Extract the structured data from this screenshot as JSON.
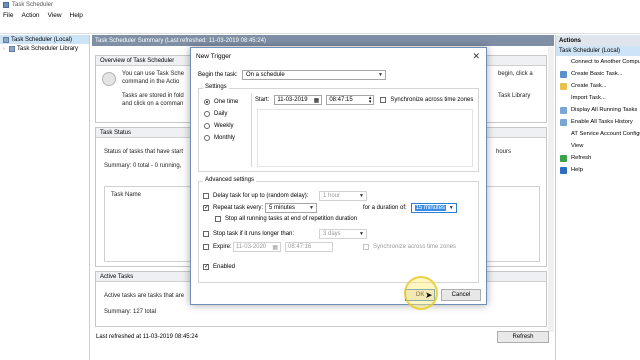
{
  "window": {
    "title": "Task Scheduler"
  },
  "menu": [
    "File",
    "Action",
    "View",
    "Help"
  ],
  "tree": {
    "root": "Task Scheduler (Local)",
    "child": "Task Scheduler Library"
  },
  "center": {
    "header": "Task Scheduler Summary (Last refreshed: 11-03-2019 08:45:24)",
    "overview": {
      "title": "Overview of Task Scheduler",
      "line1": "You can use Task Sche",
      "line2": "command in the Actio",
      "line3": "Tasks are stored in fold",
      "line4": "and click on a comman",
      "right1": "begin, click a",
      "right2": "Task Library"
    },
    "status": {
      "title": "Task Status",
      "line1": "Status of tasks that have start",
      "summary": "Summary: 0 total - 0 running,",
      "table_header": "Task Name",
      "right": "hours"
    },
    "active": {
      "title": "Active Tasks",
      "line1": "Active tasks are tasks that are",
      "summary": "Summary: 127 total"
    },
    "last_refreshed": "Last refreshed at 11-03-2019 08:45:24",
    "refresh_button": "Refresh"
  },
  "actions": {
    "title": "Actions",
    "subtitle": "Task Scheduler (Local)",
    "items": [
      {
        "label": "Connect to Another Compu",
        "icon": "connect-icon",
        "color": "#ffffff"
      },
      {
        "label": "Create Basic Task...",
        "icon": "create-basic-task-icon",
        "color": "#5a8fd0"
      },
      {
        "label": "Create Task...",
        "icon": "create-task-icon",
        "color": "#e8c14a"
      },
      {
        "label": "Import Task...",
        "icon": "import-icon",
        "color": "#ffffff"
      },
      {
        "label": "Display All Running Tasks",
        "icon": "running-tasks-icon",
        "color": "#7aa6d6"
      },
      {
        "label": "Enable All Tasks History",
        "icon": "history-icon",
        "color": "#7aa6d6"
      },
      {
        "label": "AT Service Account Configu",
        "icon": "service-account-icon",
        "color": "#ffffff"
      },
      {
        "label": "View",
        "icon": "view-icon",
        "color": "#ffffff"
      },
      {
        "label": "Refresh",
        "icon": "refresh-icon",
        "color": "#3aa34a"
      },
      {
        "label": "Help",
        "icon": "help-icon",
        "color": "#2e6cc1"
      }
    ]
  },
  "dialog": {
    "title": "New Trigger",
    "begin_label": "Begin the task:",
    "begin_value": "On a schedule",
    "settings_label": "Settings",
    "radios": [
      "One time",
      "Daily",
      "Weekly",
      "Monthly"
    ],
    "start_label": "Start:",
    "start_date": "11-03-2019",
    "start_time": "08:47:15",
    "sync_label": "Synchronize across time zones",
    "advanced_label": "Advanced settings",
    "delay_label": "Delay task for up to (random delay):",
    "delay_value": "1 hour",
    "repeat_label": "Repeat task every:",
    "repeat_value": "5 minutes",
    "duration_label": "for a duration of:",
    "duration_value": "15 minutes",
    "stop_running_label": "Stop all running tasks at end of repetition duration",
    "stop_longer_label": "Stop task if it runs longer than:",
    "stop_longer_value": "3 days",
    "expire_label": "Expire:",
    "expire_date": "11-03-2020",
    "expire_time": "08:47:16",
    "expire_sync_label": "Synchronize across time zones",
    "enabled_label": "Enabled",
    "ok_label": "OK",
    "cancel_label": "Cancel"
  }
}
